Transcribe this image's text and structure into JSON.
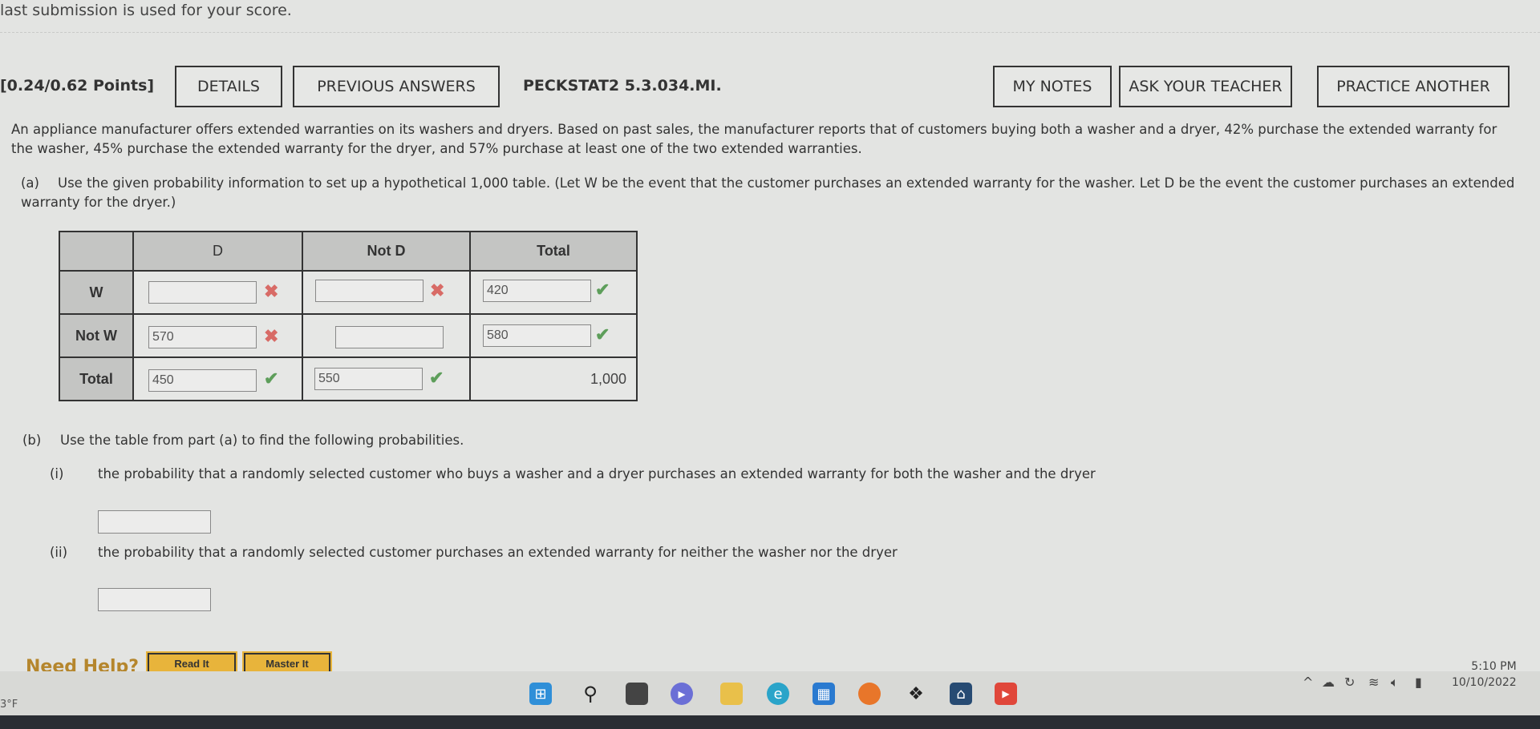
{
  "top_note": "last submission is used for your score.",
  "header": {
    "points": "[0.24/0.62 Points]",
    "details": "DETAILS",
    "previous_answers": "PREVIOUS ANSWERS",
    "question_id": "PECKSTAT2 5.3.034.MI.",
    "my_notes": "MY NOTES",
    "ask_teacher": "ASK YOUR TEACHER",
    "practice_another": "PRACTICE ANOTHER"
  },
  "problem": "An appliance manufacturer offers extended warranties on its washers and dryers. Based on past sales, the manufacturer reports that of customers buying both a washer and a dryer, 42% purchase the extended warranty for the washer, 45% purchase the extended warranty for the dryer, and 57% purchase at least one of the two extended warranties.",
  "part_a": {
    "label": "(a)",
    "text": "Use the given probability information to set up a hypothetical 1,000 table. (Let W be the event that the customer purchases an extended warranty for the washer. Let D be the event the customer purchases an extended warranty for the dryer.)"
  },
  "table": {
    "headers": [
      "",
      "D",
      "Not D",
      "Total"
    ],
    "rows": [
      {
        "label": "W",
        "cells": [
          {
            "value": "",
            "status": "incorrect"
          },
          {
            "value": "",
            "status": "incorrect"
          },
          {
            "value": "420",
            "status": "correct"
          }
        ]
      },
      {
        "label": "Not W",
        "cells": [
          {
            "value": "570",
            "status": "incorrect"
          },
          {
            "value": "",
            "status": "none"
          },
          {
            "value": "580",
            "status": "correct"
          }
        ]
      },
      {
        "label": "Total",
        "cells": [
          {
            "value": "450",
            "status": "correct"
          },
          {
            "value": "550",
            "status": "correct"
          },
          {
            "value": "1,000",
            "status": "static"
          }
        ]
      }
    ]
  },
  "part_b": {
    "label": "(b)",
    "text": "Use the table from part (a) to find the following probabilities.",
    "i": {
      "label": "(i)",
      "text": "the probability that a randomly selected customer who buys a washer and a dryer purchases an extended warranty for both the washer and the dryer",
      "value": ""
    },
    "ii": {
      "label": "(ii)",
      "text": "the probability that a randomly selected customer purchases an extended warranty for neither the washer nor the dryer",
      "value": ""
    }
  },
  "help": {
    "label": "Need Help?",
    "read_it": "Read It",
    "master_it": "Master It"
  },
  "taskbar": {
    "weather": "3°F",
    "time": "5:10 PM",
    "date": "10/10/2022",
    "icons": [
      "windows-start",
      "search",
      "task-view",
      "teams-chat",
      "file-explorer",
      "edge",
      "microsoft-store",
      "firefox",
      "dropbox",
      "app",
      "youtube"
    ]
  },
  "colors": {
    "correct": "#5d9e5a",
    "incorrect": "#d86b66",
    "help": "#b5862d",
    "help_button": "#e8b43b"
  }
}
